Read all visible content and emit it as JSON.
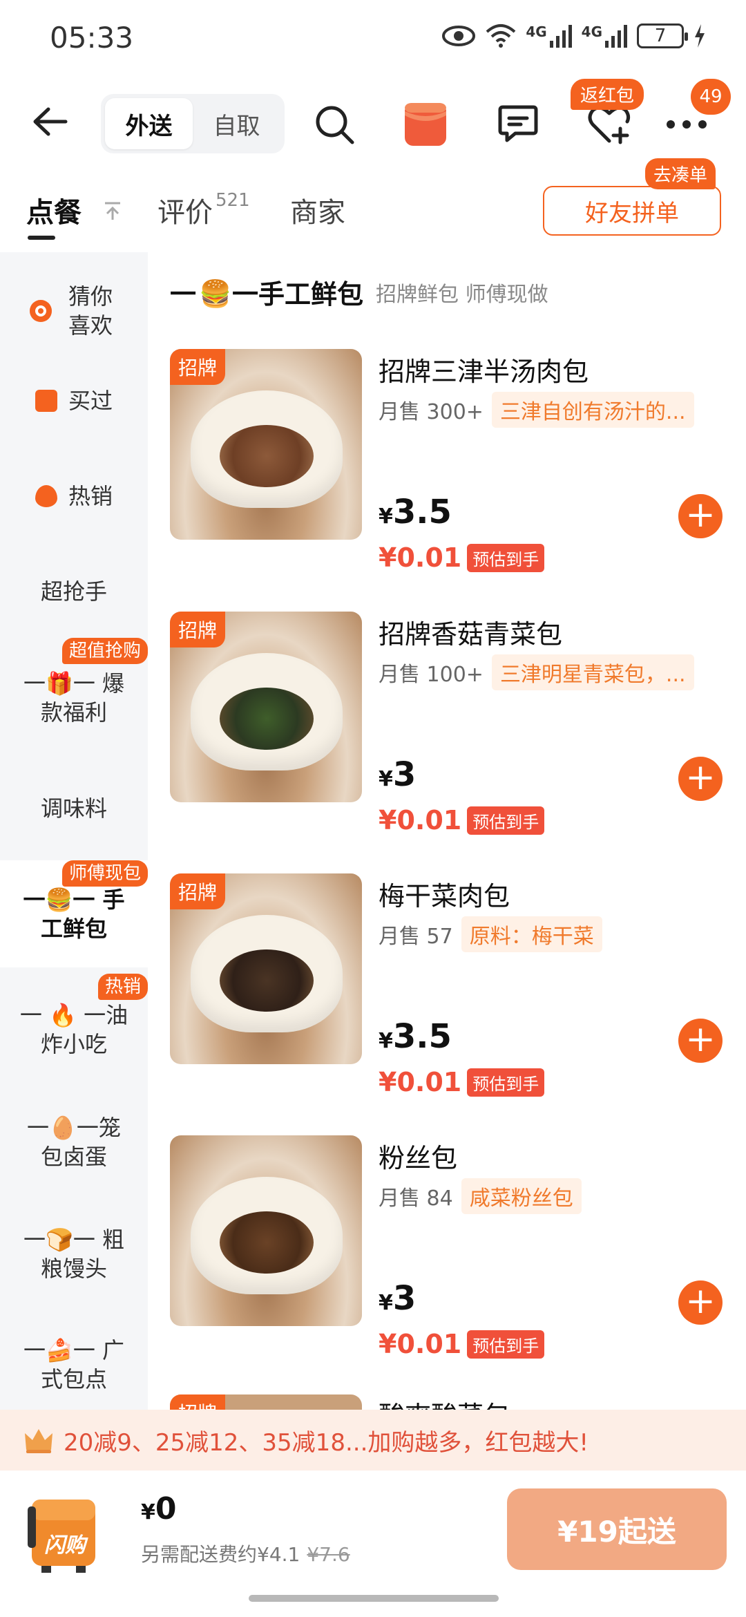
{
  "status_bar": {
    "time": "05:33",
    "net1": "4G",
    "net2": "4G",
    "battery": "7"
  },
  "header": {
    "seg_delivery": "外送",
    "seg_pickup": "自取",
    "badge_hongbao": "返红包",
    "badge_count": "49"
  },
  "tabs": {
    "order": "点餐",
    "reviews": "评价",
    "reviews_count": "521",
    "merchant": "商家",
    "friend_order": "好友拼单",
    "friend_badge": "去凑单"
  },
  "sidebar": {
    "items": [
      {
        "label": "猜你喜欢"
      },
      {
        "label": "买过"
      },
      {
        "label": "热销"
      },
      {
        "label": "超抢手"
      },
      {
        "label": "款福利",
        "prefix": "爆",
        "tag": "超值抢购"
      },
      {
        "label": "调味料"
      },
      {
        "label": "工鲜包",
        "prefix": "手",
        "tag": "师傅现包"
      },
      {
        "label": "炸小吃",
        "prefix": "油",
        "tag": "热销"
      },
      {
        "label": "包卤蛋",
        "prefix": "笼"
      },
      {
        "label": "粮馒头",
        "prefix": "粗"
      },
      {
        "label": "式包点",
        "prefix": "广"
      }
    ]
  },
  "section": {
    "title": "手工鲜包",
    "subtitle": "招牌鲜包 师傅现做"
  },
  "products": [
    {
      "tag": "招牌",
      "name": "招牌三津半汤肉包",
      "sales": "月售 300+",
      "desc": "三津自创有汤汁的...",
      "yen": "¥",
      "price": "3.5",
      "est_price": "¥0.01",
      "est_label": "预估到手",
      "add": "+"
    },
    {
      "tag": "招牌",
      "name": "招牌香菇青菜包",
      "sales": "月售 100+",
      "desc": "三津明星青菜包，...",
      "yen": "¥",
      "price": "3",
      "est_price": "¥0.01",
      "est_label": "预估到手",
      "add": "+"
    },
    {
      "tag": "招牌",
      "name": "梅干菜肉包",
      "sales": "月售 57",
      "desc": "原料：梅干菜",
      "yen": "¥",
      "price": "3.5",
      "est_price": "¥0.01",
      "est_label": "预估到手",
      "add": "+"
    },
    {
      "tag": "",
      "name": "粉丝包",
      "sales": "月售 84",
      "desc": "咸菜粉丝包",
      "yen": "¥",
      "price": "3",
      "est_price": "¥0.01",
      "est_label": "预估到手",
      "add": "+"
    }
  ],
  "peek": {
    "tag": "招牌",
    "name": "酸爽酸菜包"
  },
  "promo": {
    "text": "20减9、25减12、35减18...加购越多，红包越大!"
  },
  "cart": {
    "yen": "¥",
    "total": "0",
    "fee_text": "另需配送费约¥4.1",
    "fee_original": "¥7.6",
    "min_order": "¥19起送",
    "bag_label": "闪购"
  },
  "colors": {
    "accent": "#f4621f",
    "price_red": "#f0503a",
    "promo_bg": "#fdeee6",
    "cart_btn": "#f2a983"
  }
}
